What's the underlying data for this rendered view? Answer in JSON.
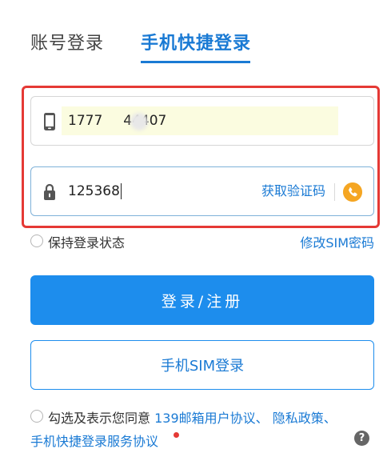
{
  "tabs": {
    "account": "账号登录",
    "phone": "手机快捷登录"
  },
  "phone_field": {
    "value_prefix": "1777",
    "value_suffix": "44407"
  },
  "code_field": {
    "value": "125368",
    "get_code_label": "获取验证码"
  },
  "keep_login": {
    "label": "保持登录状态"
  },
  "modify_sim": {
    "label": "修改SIM密码"
  },
  "buttons": {
    "login_register": "登录/注册",
    "sim_login": "手机SIM登录"
  },
  "agreement": {
    "prefix": "勾选及表示您同意",
    "link1": "139邮箱用户协议、",
    "link2": "隐私政策、",
    "link3": "手机快捷登录服务协议"
  },
  "help": {
    "glyph": "?"
  },
  "colors": {
    "accent": "#1a7ad4",
    "primary_button": "#1d8ded",
    "highlight_frame": "#e53935",
    "voice_icon": "#f5a623"
  },
  "icons": {
    "phone_field": "mobile-phone-icon",
    "code_field": "lock-icon",
    "voice": "voice-code-icon",
    "help": "help-icon"
  }
}
